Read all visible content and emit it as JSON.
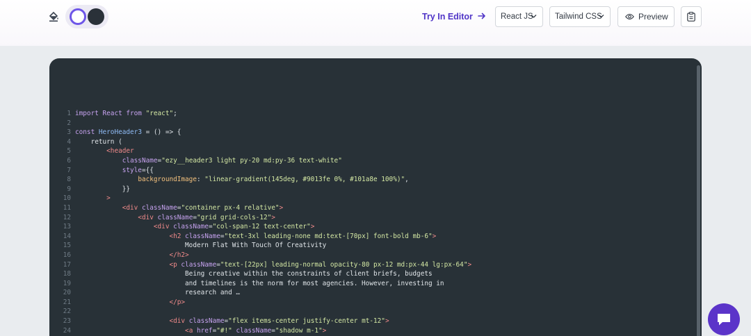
{
  "toolbar": {
    "try_editor_label": "Try In Editor",
    "framework_select": "React JS",
    "css_select": "Tailwind CSS",
    "preview_label": "Preview"
  },
  "colors": {
    "accent": "#5b34c9",
    "code_background": "#283137",
    "page_background": "#e9ecef"
  },
  "icons": {
    "paint": "paint-bucket-icon",
    "arrow": "arrow-right-icon",
    "chevron": "chevron-down-icon",
    "eye": "eye-icon",
    "copy": "clipboard-icon",
    "chat": "chat-icon"
  },
  "code": {
    "language": "jsx",
    "lines": [
      {
        "n": "1",
        "tokens": [
          {
            "t": "import React from ",
            "c": "kw"
          },
          {
            "t": "\"react\"",
            "c": "str"
          },
          {
            "t": ";",
            "c": ""
          }
        ]
      },
      {
        "n": "2",
        "tokens": [
          {
            "t": "",
            "c": ""
          }
        ]
      },
      {
        "n": "3",
        "tokens": [
          {
            "t": "const ",
            "c": "kw"
          },
          {
            "t": "HeroHeader3",
            "c": "fn"
          },
          {
            "t": " = () => {",
            "c": ""
          }
        ]
      },
      {
        "n": "4",
        "tokens": [
          {
            "t": "    return (",
            "c": ""
          }
        ]
      },
      {
        "n": "5",
        "tokens": [
          {
            "t": "        ",
            "c": ""
          },
          {
            "t": "<header",
            "c": "tag"
          }
        ]
      },
      {
        "n": "6",
        "tokens": [
          {
            "t": "            ",
            "c": ""
          },
          {
            "t": "className",
            "c": "attr"
          },
          {
            "t": "=",
            "c": ""
          },
          {
            "t": "\"ezy__header3 light py-20 md:py-36 text-white\"",
            "c": "str"
          }
        ]
      },
      {
        "n": "7",
        "tokens": [
          {
            "t": "            ",
            "c": ""
          },
          {
            "t": "style",
            "c": "attr"
          },
          {
            "t": "={{",
            "c": ""
          }
        ]
      },
      {
        "n": "8",
        "tokens": [
          {
            "t": "                ",
            "c": ""
          },
          {
            "t": "backgroundImage",
            "c": "prop"
          },
          {
            "t": ": ",
            "c": ""
          },
          {
            "t": "\"linear-gradient(145deg, #9013fe 0%, #101a8e 100%)\"",
            "c": "str"
          },
          {
            "t": ",",
            "c": ""
          }
        ]
      },
      {
        "n": "9",
        "tokens": [
          {
            "t": "            }}",
            "c": ""
          }
        ]
      },
      {
        "n": "10",
        "tokens": [
          {
            "t": "        ",
            "c": ""
          },
          {
            "t": ">",
            "c": "tag"
          }
        ]
      },
      {
        "n": "11",
        "tokens": [
          {
            "t": "            ",
            "c": ""
          },
          {
            "t": "<div ",
            "c": "tag"
          },
          {
            "t": "className",
            "c": "attr"
          },
          {
            "t": "=",
            "c": ""
          },
          {
            "t": "\"container px-4 relative\"",
            "c": "str"
          },
          {
            "t": ">",
            "c": "tag"
          }
        ]
      },
      {
        "n": "12",
        "tokens": [
          {
            "t": "                ",
            "c": ""
          },
          {
            "t": "<div ",
            "c": "tag"
          },
          {
            "t": "className",
            "c": "attr"
          },
          {
            "t": "=",
            "c": ""
          },
          {
            "t": "\"grid grid-cols-12\"",
            "c": "str"
          },
          {
            "t": ">",
            "c": "tag"
          }
        ]
      },
      {
        "n": "13",
        "tokens": [
          {
            "t": "                    ",
            "c": ""
          },
          {
            "t": "<div ",
            "c": "tag"
          },
          {
            "t": "className",
            "c": "attr"
          },
          {
            "t": "=",
            "c": ""
          },
          {
            "t": "\"col-span-12 text-center\"",
            "c": "str"
          },
          {
            "t": ">",
            "c": "tag"
          }
        ]
      },
      {
        "n": "14",
        "tokens": [
          {
            "t": "                        ",
            "c": ""
          },
          {
            "t": "<h2 ",
            "c": "tag"
          },
          {
            "t": "className",
            "c": "attr"
          },
          {
            "t": "=",
            "c": ""
          },
          {
            "t": "\"text-3xl leading-none md:text-[70px] font-bold mb-6\"",
            "c": "str"
          },
          {
            "t": ">",
            "c": "tag"
          }
        ]
      },
      {
        "n": "15",
        "tokens": [
          {
            "t": "                            Modern Flat With Touch Of Creativity",
            "c": ""
          }
        ]
      },
      {
        "n": "16",
        "tokens": [
          {
            "t": "                        ",
            "c": ""
          },
          {
            "t": "</h2>",
            "c": "tag"
          }
        ]
      },
      {
        "n": "17",
        "tokens": [
          {
            "t": "                        ",
            "c": ""
          },
          {
            "t": "<p ",
            "c": "tag"
          },
          {
            "t": "className",
            "c": "attr"
          },
          {
            "t": "=",
            "c": ""
          },
          {
            "t": "\"text-[22px] leading-normal opacity-80 px-12 md:px-44 lg:px-64\"",
            "c": "str"
          },
          {
            "t": ">",
            "c": "tag"
          }
        ]
      },
      {
        "n": "18",
        "tokens": [
          {
            "t": "                            Being creative within the constraints of client briefs, budgets",
            "c": ""
          }
        ]
      },
      {
        "n": "19",
        "tokens": [
          {
            "t": "                            and timelines is the norm for most agencies. However, investing in",
            "c": ""
          }
        ]
      },
      {
        "n": "20",
        "tokens": [
          {
            "t": "                            research and …",
            "c": ""
          }
        ]
      },
      {
        "n": "21",
        "tokens": [
          {
            "t": "                        ",
            "c": ""
          },
          {
            "t": "</p>",
            "c": "tag"
          }
        ]
      },
      {
        "n": "22",
        "tokens": [
          {
            "t": "",
            "c": ""
          }
        ]
      },
      {
        "n": "23",
        "tokens": [
          {
            "t": "                        ",
            "c": ""
          },
          {
            "t": "<div ",
            "c": "tag"
          },
          {
            "t": "className",
            "c": "attr"
          },
          {
            "t": "=",
            "c": ""
          },
          {
            "t": "\"flex items-center justify-center mt-12\"",
            "c": "str"
          },
          {
            "t": ">",
            "c": "tag"
          }
        ]
      },
      {
        "n": "24",
        "tokens": [
          {
            "t": "                            ",
            "c": ""
          },
          {
            "t": "<a ",
            "c": "tag"
          },
          {
            "t": "href",
            "c": "attr"
          },
          {
            "t": "=",
            "c": ""
          },
          {
            "t": "\"#!\"",
            "c": "str"
          },
          {
            "t": " ",
            "c": ""
          },
          {
            "t": "className",
            "c": "attr"
          },
          {
            "t": "=",
            "c": ""
          },
          {
            "t": "\"shadow m-1\"",
            "c": "str"
          },
          {
            "t": ">",
            "c": "tag"
          }
        ]
      }
    ]
  }
}
